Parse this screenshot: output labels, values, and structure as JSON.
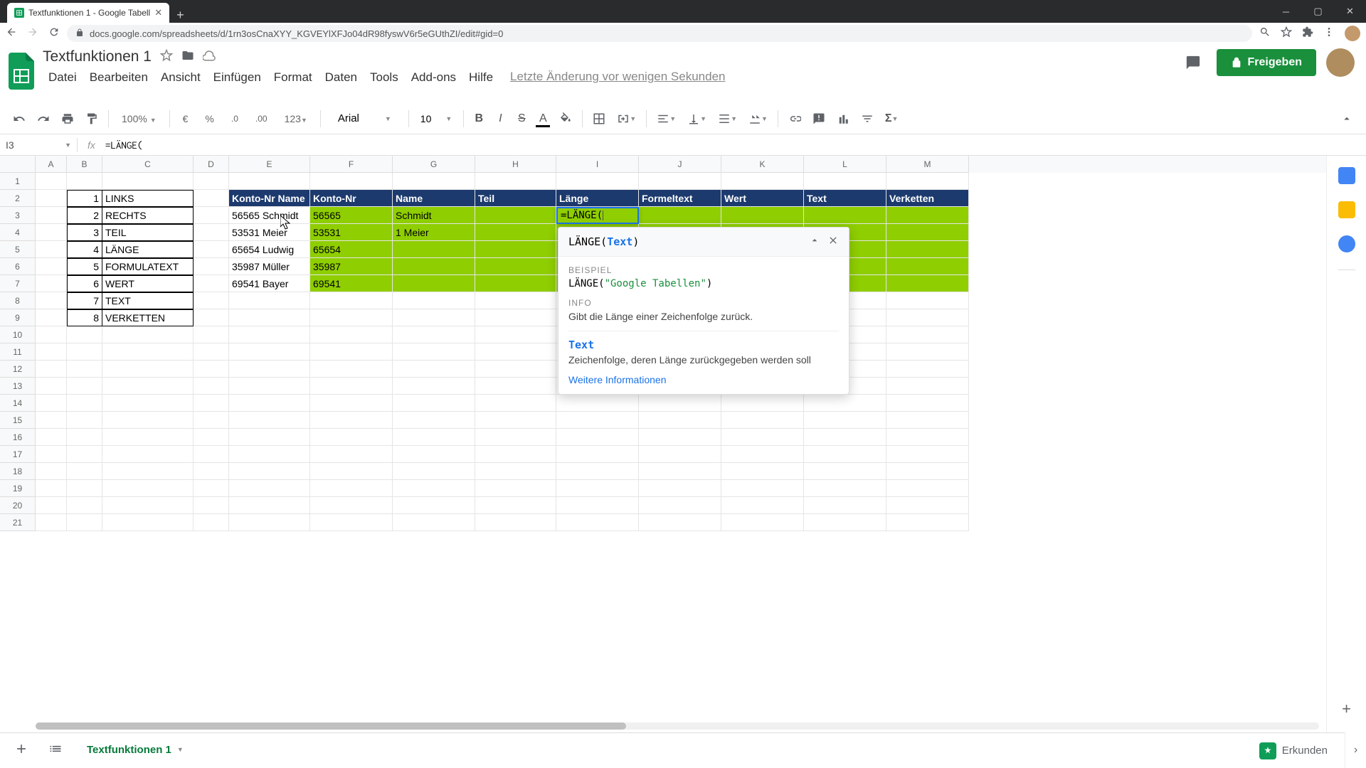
{
  "browser": {
    "tab_title": "Textfunktionen 1 - Google Tabell",
    "url": "docs.google.com/spreadsheets/d/1rn3osCnaXYY_KGVEYlXFJo04dR98fyswV6r5eGUthZI/edit#gid=0"
  },
  "doc": {
    "title": "Textfunktionen 1",
    "menus": [
      "Datei",
      "Bearbeiten",
      "Ansicht",
      "Einfügen",
      "Format",
      "Daten",
      "Tools",
      "Add-ons",
      "Hilfe"
    ],
    "last_edit": "Letzte Änderung vor wenigen Sekunden",
    "share_label": "Freigeben"
  },
  "toolbar": {
    "zoom": "100%",
    "currency": "€",
    "percent": "%",
    "dec_minus": ".0",
    "dec_plus": ".00",
    "numfmt": "123",
    "font": "Arial",
    "font_size": "10"
  },
  "namebox": "I3",
  "formula": "=LÄNGE(",
  "cell_edit_value": "=LÄNGE(",
  "columns": [
    "A",
    "B",
    "C",
    "D",
    "E",
    "F",
    "G",
    "H",
    "I",
    "J",
    "K",
    "L",
    "M"
  ],
  "rows_count": 21,
  "left_table": {
    "nums": [
      "1",
      "2",
      "3",
      "4",
      "5",
      "6",
      "7",
      "8"
    ],
    "names": [
      "LINKS",
      "RECHTS",
      "TEIL",
      "LÄNGE",
      "FORMULATEXT",
      "WERT",
      "TEXT",
      "VERKETTEN"
    ]
  },
  "headers": [
    "Konto-Nr Name",
    "Konto-Nr",
    "Name",
    "Teil",
    "Länge",
    "Formeltext",
    "Wert",
    "Text",
    "Verketten"
  ],
  "data_rows": [
    {
      "e": "56565 Schmidt",
      "f": "56565",
      "g": "Schmidt"
    },
    {
      "e": "53531 Meier",
      "f": "53531",
      "g": "1 Meier"
    },
    {
      "e": "65654 Ludwig",
      "f": "65654",
      "g": ""
    },
    {
      "e": "35987 Müller",
      "f": "35987",
      "g": ""
    },
    {
      "e": "69541 Bayer",
      "f": "69541",
      "g": ""
    }
  ],
  "help": {
    "sig_prefix": "LÄNGE(",
    "sig_param": "Text",
    "sig_suffix": ")",
    "example_label": "BEISPIEL",
    "example_prefix": "LÄNGE(",
    "example_str": "\"Google Tabellen\"",
    "example_suffix": ")",
    "info_label": "INFO",
    "info_text": "Gibt die Länge einer Zeichenfolge zurück.",
    "param_name": "Text",
    "param_desc": "Zeichenfolge, deren Länge zurückgegeben werden soll",
    "link": "Weitere Informationen"
  },
  "sheet_tab": "Textfunktionen 1",
  "explore": "Erkunden"
}
